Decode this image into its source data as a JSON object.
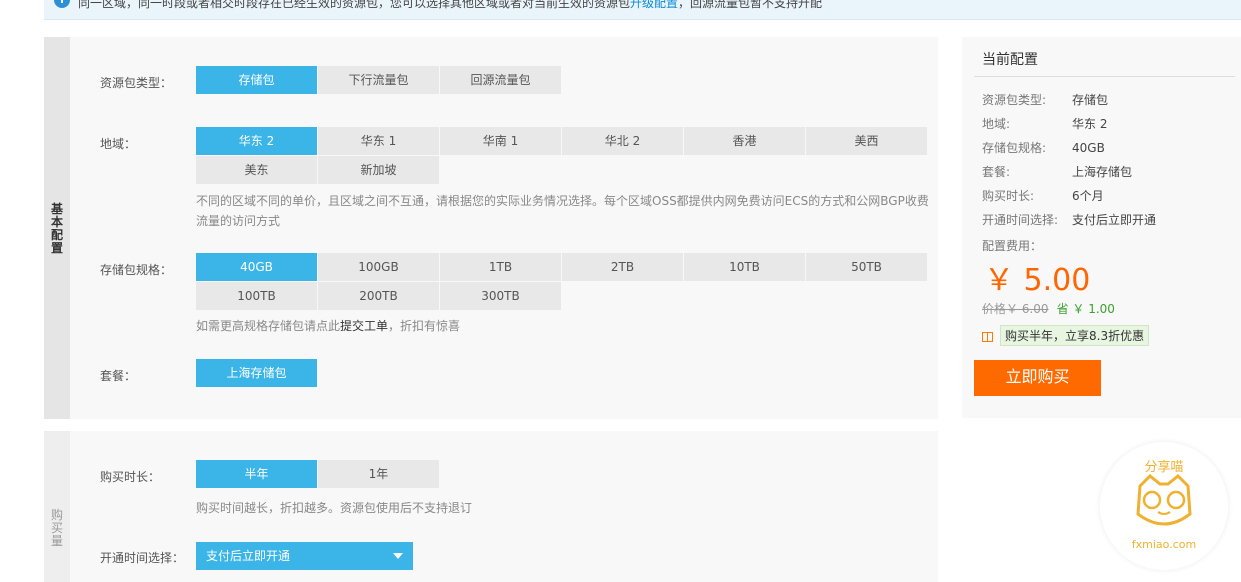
{
  "notice": {
    "icon": "info-icon",
    "text": "同一区域，同一时段或者相交时段存在已经生效的资源包，您可以选择其他区域或者对当前生效的资源包",
    "link": "升级配置",
    "tail": "，回源流量包暂不支持升配"
  },
  "basic": {
    "side_label": "基本配置",
    "type": {
      "label": "资源包类型：",
      "options": [
        "存储包",
        "下行流量包",
        "回源流量包"
      ],
      "selected": "存储包"
    },
    "region": {
      "label": "地域：",
      "options": [
        "华东 2",
        "华东 1",
        "华南 1",
        "华北 2",
        "香港",
        "美西",
        "美东",
        "新加坡"
      ],
      "selected": "华东 2",
      "hint": "不同的区域不同的单价，且区域之间不互通，请根据您的实际业务情况选择。每个区域OSS都提供内网免费访问ECS的方式和公网BGP收费流量的访问方式"
    },
    "size": {
      "label": "存储包规格：",
      "options": [
        "40GB",
        "100GB",
        "1TB",
        "2TB",
        "10TB",
        "50TB",
        "100TB",
        "200TB",
        "300TB"
      ],
      "selected": "40GB",
      "hint_pre": "如需更高规格存储包请点此",
      "hint_link": "提交工单",
      "hint_post": "，折扣有惊喜"
    },
    "plan": {
      "label": "套餐：",
      "options": [
        "上海存储包"
      ],
      "selected": "上海存储包"
    }
  },
  "purchase": {
    "side_label": "购买量",
    "duration": {
      "label": "购买时长：",
      "options": [
        "半年",
        "1年"
      ],
      "selected": "半年",
      "hint": "购买时间越长，折扣越多。资源包使用后不支持退订"
    },
    "activation": {
      "label": "开通时间选择：",
      "value": "支付后立即开通"
    }
  },
  "summary": {
    "title": "当前配置",
    "rows": [
      {
        "k": "资源包类型:",
        "v": "存储包"
      },
      {
        "k": "地域:",
        "v": "华东 2"
      },
      {
        "k": "存储包规格:",
        "v": "40GB"
      },
      {
        "k": "套餐:",
        "v": "上海存储包"
      },
      {
        "k": "购买时长:",
        "v": "6个月"
      },
      {
        "k": "开通时间选择:",
        "v": "支付后立即开通"
      }
    ],
    "fee_label": "配置费用：",
    "price": "￥ 5.00",
    "orig_label": "价格",
    "orig_price": "￥ 6.00",
    "save_label": "省",
    "save_amount": "￥ 1.00",
    "promo": "购买半年，立享8.3折优惠",
    "buy_label": "立即购买"
  },
  "watermark": {
    "top": "分享喵",
    "bottom": "fxmiao.com"
  },
  "colors": {
    "selected": "#3bb5e8",
    "unselected": "#e8e8e8",
    "price": "#ff6600",
    "buy_button": "#ff6a00",
    "save": "#3aa12d",
    "link": "#0c8ad6"
  }
}
